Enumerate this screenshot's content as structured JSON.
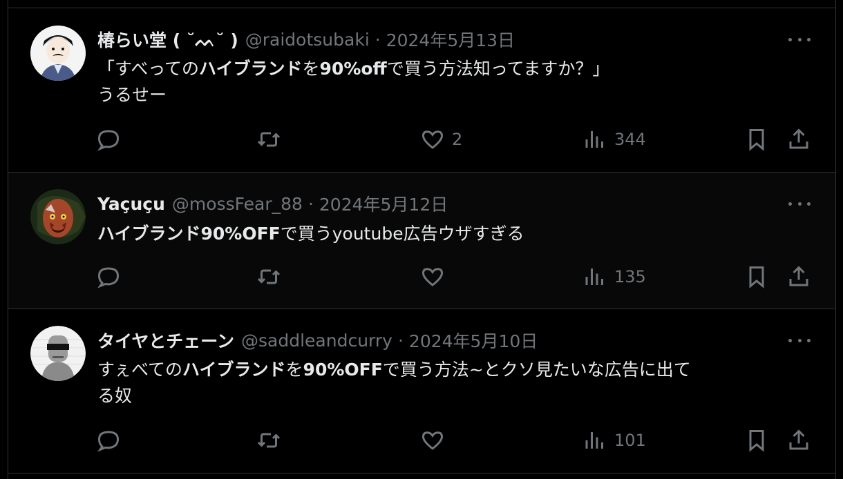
{
  "tweets": [
    {
      "name": "椿らい堂 ( ˘ᨓ˘ )",
      "handle": "@raidotsubaki",
      "date": "2024年5月13日",
      "lines": [
        [
          {
            "t": "「すべっての",
            "b": false
          },
          {
            "t": "ハイブランド",
            "b": true
          },
          {
            "t": "を",
            "b": false
          },
          {
            "t": "90%off",
            "b": true
          },
          {
            "t": "で買う方法知ってますか？」",
            "b": false
          }
        ],
        [
          {
            "t": "うるせー",
            "b": false
          }
        ]
      ],
      "reply_count": "",
      "retweet_count": "",
      "like_count": "2",
      "view_count": "344"
    },
    {
      "name": "Yaçuçu",
      "handle": "@mossFear_88",
      "date": "2024年5月12日",
      "lines": [
        [
          {
            "t": "ハイブランド90%OFF",
            "b": true
          },
          {
            "t": "で買うyoutube広告ウザすぎる",
            "b": false
          }
        ]
      ],
      "reply_count": "",
      "retweet_count": "",
      "like_count": "",
      "view_count": "135"
    },
    {
      "name": "タイヤとチェーン",
      "handle": "@saddleandcurry",
      "date": "2024年5月10日",
      "lines": [
        [
          {
            "t": "すぇべての",
            "b": false
          },
          {
            "t": "ハイブランド",
            "b": true
          },
          {
            "t": "を",
            "b": false
          },
          {
            "t": "90%OFF",
            "b": true
          },
          {
            "t": "で買う方法~とクソ見たいな広告に出て",
            "b": false
          }
        ],
        [
          {
            "t": "る奴",
            "b": false
          }
        ]
      ],
      "reply_count": "",
      "retweet_count": "",
      "like_count": "",
      "view_count": "101"
    }
  ],
  "separator": "·",
  "icons": {
    "reply": "speech-bubble-icon",
    "retweet": "retweet-arrows-icon",
    "like": "heart-icon",
    "views": "bar-chart-icon",
    "bookmark": "bookmark-icon",
    "share": "share-upload-icon",
    "more": "more-dots-icon"
  },
  "colors": {
    "background": "#000000",
    "text": "#e7e9ea",
    "muted": "#71767b",
    "border": "#2f3336"
  }
}
